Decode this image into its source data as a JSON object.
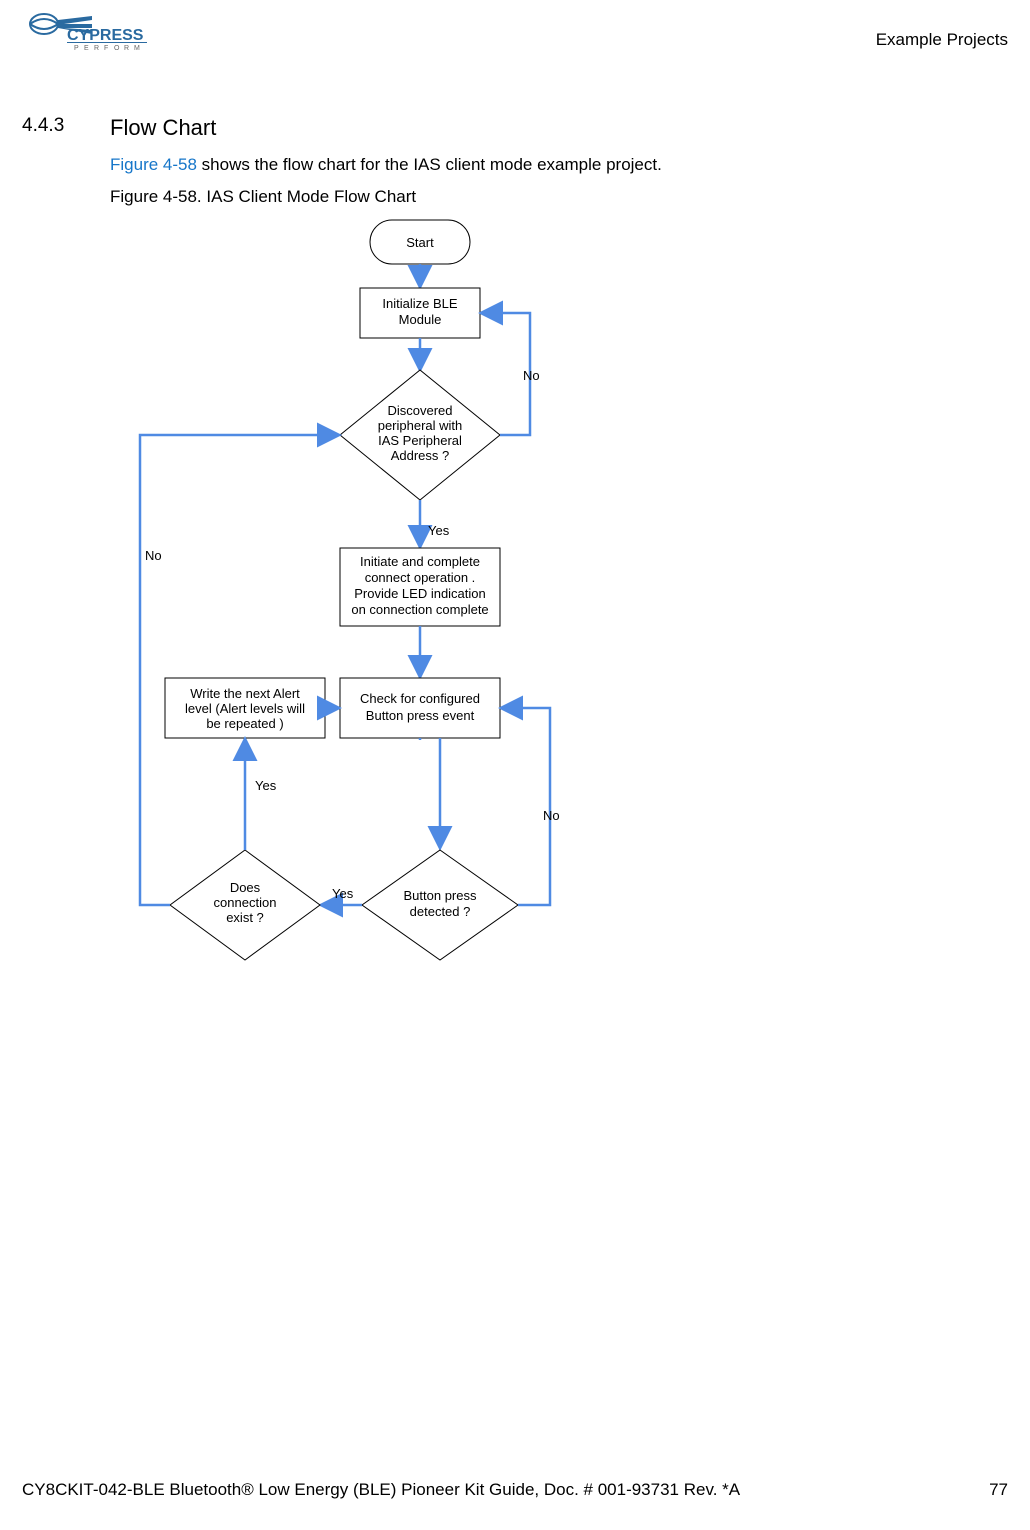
{
  "header": {
    "right": "Example Projects"
  },
  "logo": {
    "brand": "CYPRESS",
    "tag_letters": [
      "P",
      "E",
      "R",
      "F",
      "O",
      "R",
      "M"
    ]
  },
  "section": {
    "number": "4.4.3",
    "title": "Flow Chart",
    "intro_ref": "Figure 4-58",
    "intro_rest": " shows the flow chart for the IAS client mode example project.",
    "fig_caption": "Figure 4-58.  IAS Client Mode Flow Chart"
  },
  "flow": {
    "nodes": {
      "start": "Start",
      "init": {
        "l1": "Initialize BLE",
        "l2": "Module"
      },
      "disc": {
        "l1": "Discovered",
        "l2": "peripheral with",
        "l3": "IAS Peripheral",
        "l4": "Address ?"
      },
      "connect": {
        "l1": "Initiate and complete",
        "l2": "connect operation  .",
        "l3": "Provide LED indication",
        "l4": "on connection complete"
      },
      "check": {
        "l1": "Check for configured",
        "l2": "Button press event"
      },
      "write": {
        "l1": "Write the next Alert",
        "l2": "level (Alert levels will",
        "l3": "be repeated )"
      },
      "btn": {
        "l1": "Button press",
        "l2": "detected  ?"
      },
      "exist": {
        "l1": "Does",
        "l2": "connection",
        "l3": "exist ?"
      }
    },
    "labels": {
      "no1": "No",
      "yes1": "Yes",
      "no2": "No",
      "yes2": "Yes",
      "no3": "No",
      "yes3": "Yes"
    }
  },
  "footer": {
    "left": "CY8CKIT-042-BLE Bluetooth® Low Energy (BLE) Pioneer Kit Guide, Doc. # 001-93731 Rev. *A",
    "right": "77"
  }
}
